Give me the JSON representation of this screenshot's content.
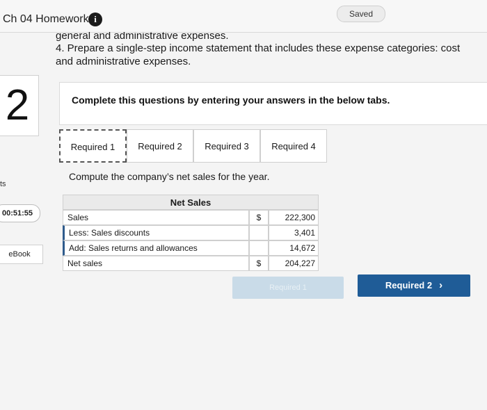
{
  "header": {
    "title": "Ch 04 Homework",
    "info_icon": "i",
    "saved_label": "Saved"
  },
  "left_rail": {
    "question_number": "2",
    "partial_label": "ts",
    "timer": "00:51:55",
    "ebook_label": "eBook"
  },
  "question": {
    "line_cut": "general and administrative expenses.",
    "line_4": "4. Prepare a single-step income statement that includes these expense categories: cost",
    "line_4b": "and administrative expenses."
  },
  "instruction": "Complete this questions by entering your answers in the below tabs.",
  "tabs": [
    {
      "label": "Required 1",
      "active": true
    },
    {
      "label": "Required 2",
      "active": false
    },
    {
      "label": "Required 3",
      "active": false
    },
    {
      "label": "Required 4",
      "active": false
    }
  ],
  "task_text": "Compute the company’s net sales for the year.",
  "table": {
    "header": "Net Sales",
    "rows": [
      {
        "label": "Sales",
        "currency": "$",
        "value": "222,300"
      },
      {
        "label": "Less: Sales discounts",
        "currency": "",
        "value": "3,401"
      },
      {
        "label": "Add: Sales returns and allowances",
        "currency": "",
        "value": "14,672"
      },
      {
        "label": "Net sales",
        "currency": "$",
        "value": "204,227"
      }
    ]
  },
  "nav": {
    "prev_label": "Required 1",
    "next_label": "Required 2",
    "next_icon": "chevron-right-icon"
  },
  "colors": {
    "next_button": "#1f5c97",
    "prev_button_disabled": "#c9dbe8"
  }
}
